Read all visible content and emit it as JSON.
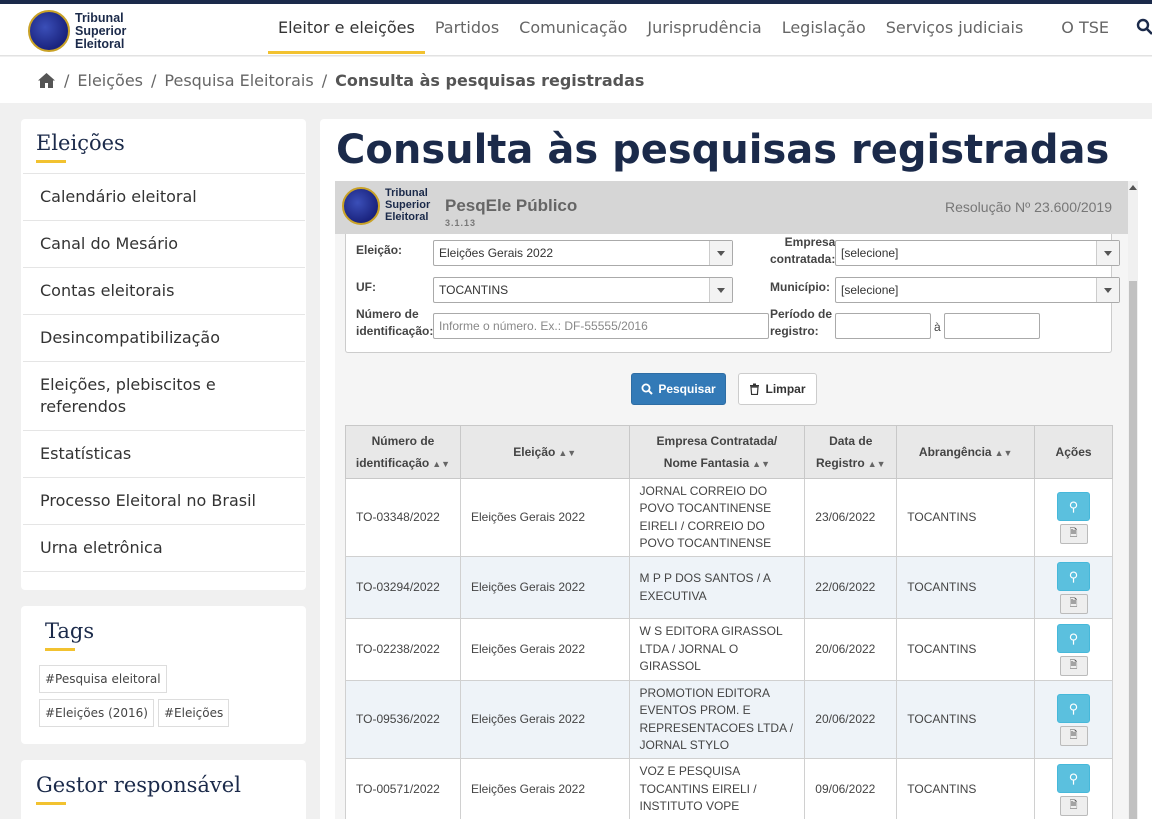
{
  "header": {
    "logo_lines": [
      "Tribunal",
      "Superior",
      "Eleitoral"
    ],
    "nav": [
      "Eleitor e eleições",
      "Partidos",
      "Comunicação",
      "Jurisprudência",
      "Legislação",
      "Serviços judiciais",
      "O TSE"
    ],
    "active_nav": "Eleitor e eleições"
  },
  "breadcrumb": {
    "items": [
      "Eleições",
      "Pesquisa Eleitorais"
    ],
    "current": "Consulta às pesquisas registradas"
  },
  "sidebar": {
    "title": "Eleições",
    "items": [
      "Calendário eleitoral",
      "Canal do Mesário",
      "Contas eleitorais",
      "Desincompatibilização",
      "Eleições, plebiscitos e referendos",
      "Estatísticas",
      "Processo Eleitoral no Brasil",
      "Urna eletrônica"
    ],
    "tags_title": "Tags",
    "tags": [
      "#Pesquisa eleitoral",
      "#Eleições (2016)",
      "#Eleições"
    ],
    "manager_title": "Gestor responsável"
  },
  "main": {
    "title": "Consulta às pesquisas registradas"
  },
  "app": {
    "logo_lines": [
      "Tribunal",
      "Superior",
      "Eleitoral"
    ],
    "name": "PesqEle Público",
    "version": "3.1.13",
    "resolution": "Resolução Nº 23.600/2019"
  },
  "form": {
    "eleicao_label": "Eleição:",
    "eleicao_value": "Eleições Gerais 2022",
    "empresa_label_1": "Empresa",
    "empresa_label_2": "contratada:",
    "empresa_value": "[selecione]",
    "uf_label": "UF:",
    "uf_value": "TOCANTINS",
    "municipio_label": "Município:",
    "municipio_value": "[selecione]",
    "numero_label_1": "Número de",
    "numero_label_2": "identificação:",
    "numero_placeholder": "Informe o número. Ex.: DF-55555/2016",
    "periodo_label_1": "Período de",
    "periodo_label_2": "registro:",
    "periodo_sep": "à",
    "search_label": "Pesquisar",
    "clear_label": "Limpar"
  },
  "table": {
    "headers": [
      "Número de identificação",
      "Eleição",
      "Empresa Contratada/ Nome Fantasia",
      "Data de Registro",
      "Abrangência",
      "Ações"
    ],
    "header_lines": [
      [
        "Número de",
        "identificação"
      ],
      [
        "Eleição"
      ],
      [
        "Empresa Contratada/",
        "Nome Fantasia"
      ],
      [
        "Data de",
        "Registro"
      ],
      [
        "Abrangência"
      ],
      [
        "Ações"
      ]
    ],
    "rows": [
      {
        "numero": "TO-03348/2022",
        "eleicao": "Eleições Gerais 2022",
        "empresa": "JORNAL CORREIO DO POVO TOCANTINENSE EIRELI / CORREIO DO POVO TOCANTINENSE",
        "data": "23/06/2022",
        "abrangencia": "TOCANTINS"
      },
      {
        "numero": "TO-03294/2022",
        "eleicao": "Eleições Gerais 2022",
        "empresa": "M P P DOS SANTOS / A EXECUTIVA",
        "data": "22/06/2022",
        "abrangencia": "TOCANTINS"
      },
      {
        "numero": "TO-02238/2022",
        "eleicao": "Eleições Gerais 2022",
        "empresa": "W S EDITORA GIRASSOL LTDA / JORNAL O GIRASSOL",
        "data": "20/06/2022",
        "abrangencia": "TOCANTINS"
      },
      {
        "numero": "TO-09536/2022",
        "eleicao": "Eleições Gerais 2022",
        "empresa": "PROMOTION EDITORA EVENTOS PROM. E REPRESENTACOES LTDA / JORNAL STYLO",
        "data": "20/06/2022",
        "abrangencia": "TOCANTINS"
      },
      {
        "numero": "TO-00571/2022",
        "eleicao": "Eleições Gerais 2022",
        "empresa": "VOZ E PESQUISA TOCANTINS EIRELI / INSTITUTO VOPE",
        "data": "09/06/2022",
        "abrangencia": "TOCANTINS"
      }
    ]
  },
  "colors": {
    "navy": "#1b2a4a",
    "accent_yellow": "#f2c230",
    "primary_button": "#337ab7",
    "info_button": "#5bc0de"
  }
}
